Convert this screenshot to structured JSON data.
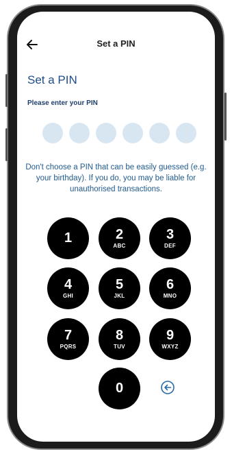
{
  "header": {
    "back_icon": "arrow-left-icon",
    "title": "Set a PIN"
  },
  "main": {
    "title": "Set a PIN",
    "pin_label": "Please enter your PIN",
    "pin_dots_count": 6,
    "pin_entered": 0,
    "warning": "Don't choose a PIN that can be easily guessed (e.g. your birthday). If you do, you may be liable for unauthorised transactions."
  },
  "keypad": {
    "keys": [
      {
        "digit": "1",
        "letters": ""
      },
      {
        "digit": "2",
        "letters": "ABC"
      },
      {
        "digit": "3",
        "letters": "DEF"
      },
      {
        "digit": "4",
        "letters": "GHI"
      },
      {
        "digit": "5",
        "letters": "JKL"
      },
      {
        "digit": "6",
        "letters": "MNO"
      },
      {
        "digit": "7",
        "letters": "PQRS"
      },
      {
        "digit": "8",
        "letters": "TUV"
      },
      {
        "digit": "9",
        "letters": "WXYZ"
      },
      {
        "digit": "0",
        "letters": ""
      }
    ],
    "delete_icon": "backspace-circle-icon"
  },
  "colors": {
    "title": "#1f4c88",
    "label": "#1f3f6b",
    "warning": "#1f5a8f",
    "pin_dot": "#d8e6f2",
    "key_bg": "#000000",
    "delete_icon": "#2a6aa8"
  }
}
